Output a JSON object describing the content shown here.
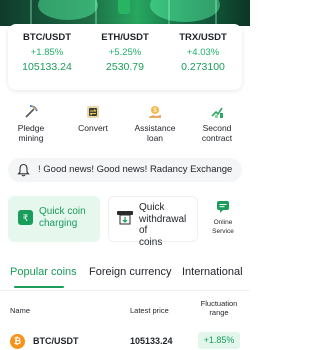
{
  "tickers": [
    {
      "pair": "BTC/USDT",
      "change": "+1.85%",
      "price": "105133.24"
    },
    {
      "pair": "ETH/USDT",
      "change": "+5.25%",
      "price": "2530.79"
    },
    {
      "pair": "TRX/USDT",
      "change": "+4.03%",
      "price": "0.273100"
    }
  ],
  "quick_actions": [
    {
      "label_line1": "Pledge",
      "label_line2": "mining",
      "icon": "pickaxe-icon"
    },
    {
      "label_line1": "Convert",
      "label_line2": "",
      "icon": "convert-icon"
    },
    {
      "label_line1": "Assistance",
      "label_line2": "loan",
      "icon": "loan-icon"
    },
    {
      "label_line1": "Second",
      "label_line2": "contract",
      "icon": "contract-icon"
    }
  ],
  "notice": {
    "text": "! Good news! Good news! Radancy Exchange"
  },
  "services": {
    "charge": {
      "line1": "Quick coin",
      "line2": "charging"
    },
    "withdraw": {
      "line1": "Quick",
      "line2": "withdrawal of",
      "line3": "coins"
    },
    "online": {
      "line1": "Online",
      "line2": "Service"
    }
  },
  "tabs": [
    "Popular coins",
    "Foreign currency",
    "International"
  ],
  "table": {
    "headers": {
      "name": "Name",
      "price": "Latest price",
      "range_line1": "Fluctuation",
      "range_line2": "range"
    },
    "rows": [
      {
        "symbol": "BTC/USDT",
        "logo": "₿",
        "price": "105133.24",
        "change": "+1.85%"
      }
    ]
  },
  "colors": {
    "accent": "#1a9c5b",
    "up": "#20b26c",
    "badge_bg": "#e3f6eb",
    "banner": "#1d6b45"
  }
}
